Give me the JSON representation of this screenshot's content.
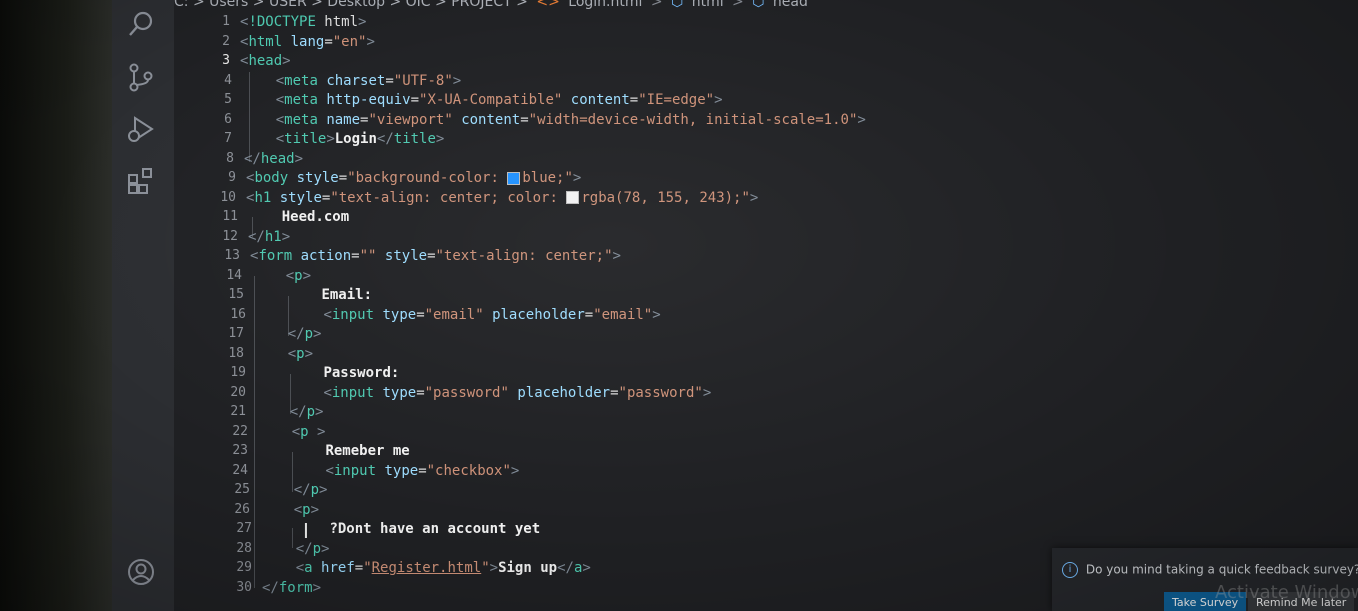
{
  "breadcrumb": {
    "path_prefix": "C: > Users > USER > Desktop > OIC > PROJECT >",
    "file": "Login.html",
    "html": "html",
    "head": "head"
  },
  "activity_bar": {
    "icons": [
      "search-icon",
      "source-control-icon",
      "run-debug-icon",
      "extensions-icon",
      "account-icon"
    ]
  },
  "editor": {
    "active_line": 3,
    "lines": [
      "<!DOCTYPE html>",
      "<html lang=\"en\">",
      "<head>",
      "    <meta charset=\"UTF-8\">",
      "    <meta http-equiv=\"X-UA-Compatible\" content=\"IE=edge\">",
      "    <meta name=\"viewport\" content=\"width=device-width, initial-scale=1.0\">",
      "    <title>Login</title>",
      "</head>",
      "<body style=\"background-color: blue;\">",
      "<h1 style=\"text-align: center; color: rgba(78, 155, 243);\">",
      "    Heed.com",
      "</h1>",
      "<form action=\"\" style=\"text-align: center;\">",
      "    <p>",
      "        Email:",
      "        <input type=\"email\" placeholder=\"email\">",
      "    </p>",
      "    <p>",
      "        Password:",
      "        <input type=\"password\" placeholder=\"password\">",
      "    </p>",
      "    <p >",
      "        Remeber me",
      "        <input type=\"checkbox\">",
      "    </p>",
      "    <p>",
      "        ?Dont have an account yet",
      "    </p>",
      "    <a href=\"Register.html\">Sign up</a>",
      "</form>"
    ]
  },
  "toast": {
    "message": "Do you mind taking a quick feedback survey?",
    "primary": "Take Survey",
    "secondary": "Remind Me later"
  },
  "watermark": "Activate Windows",
  "colors": {
    "tag": "#4ec9b0",
    "attribute": "#9cdcfe",
    "string": "#ce9178",
    "blue_swatch": "#1e90ff",
    "rgba_swatch": "#f2f2f2"
  }
}
